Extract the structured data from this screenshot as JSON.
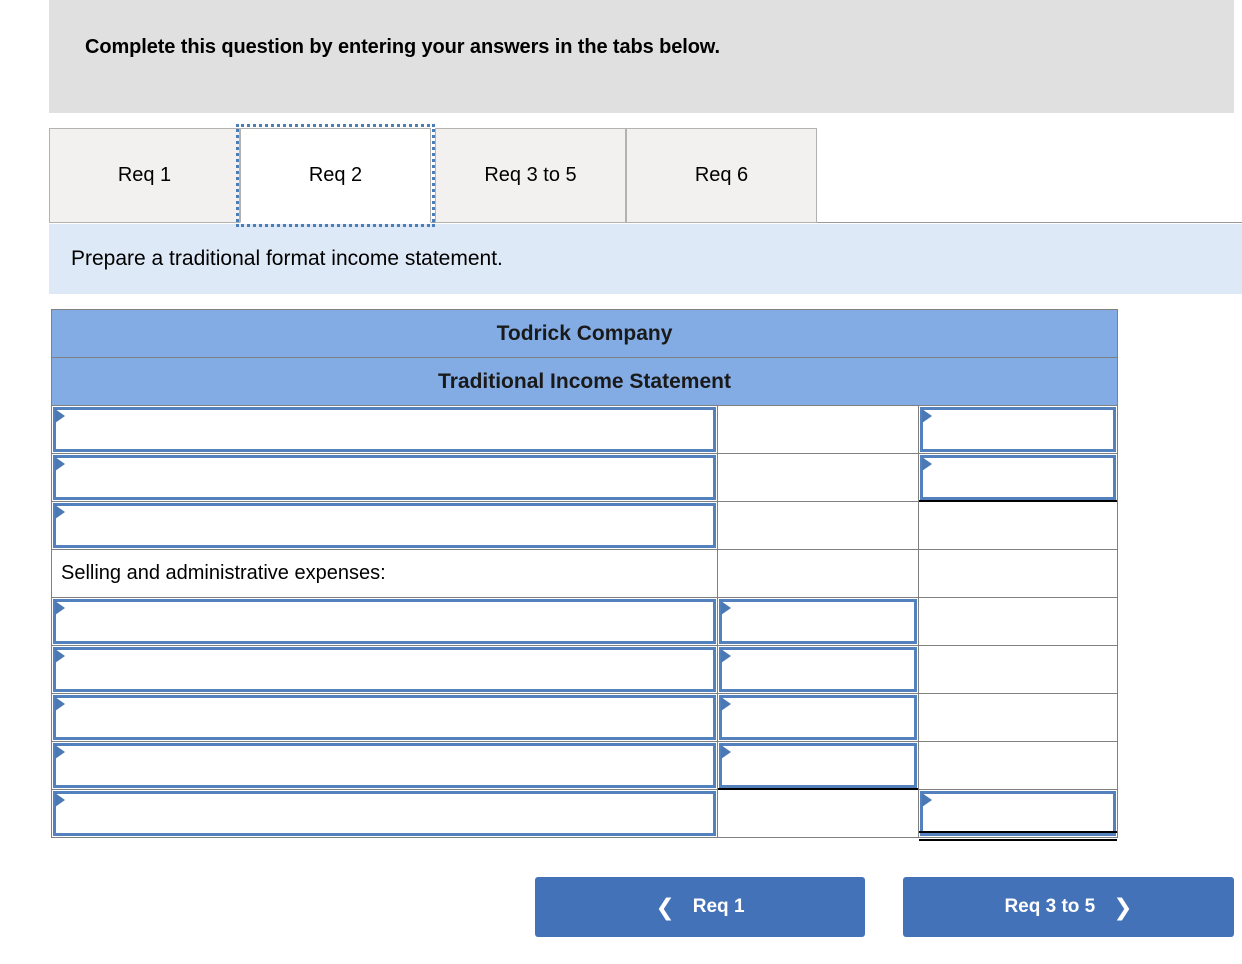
{
  "banner": {
    "text": "Complete this question by entering your answers in the tabs below."
  },
  "tabs": {
    "items": [
      {
        "label": "Req 1",
        "active": false
      },
      {
        "label": "Req 2",
        "active": true
      },
      {
        "label": "Req 3 to 5",
        "active": false
      },
      {
        "label": "Req 6",
        "active": false
      }
    ]
  },
  "prompt": {
    "text": "Prepare a traditional format income statement."
  },
  "worksheet": {
    "title": "Todrick Company",
    "subtitle": "Traditional Income Statement",
    "section_label": "Selling and administrative expenses:",
    "rows": [
      {
        "desc": "",
        "desc_input": true,
        "mid_input": false,
        "right_input": true,
        "right_rule": "none"
      },
      {
        "desc": "",
        "desc_input": true,
        "mid_input": false,
        "right_input": true,
        "right_rule": "single"
      },
      {
        "desc": "",
        "desc_input": true,
        "mid_input": false,
        "right_input": false,
        "right_rule": "none"
      },
      {
        "desc": "",
        "desc_input": true,
        "mid_input": true,
        "right_input": false,
        "right_rule": "none"
      },
      {
        "desc": "",
        "desc_input": true,
        "mid_input": true,
        "right_input": false,
        "right_rule": "none"
      },
      {
        "desc": "",
        "desc_input": true,
        "mid_input": true,
        "right_input": false,
        "right_rule": "none"
      },
      {
        "desc": "",
        "desc_input": true,
        "mid_input": true,
        "right_input": false,
        "right_rule": "none"
      },
      {
        "desc": "",
        "desc_input": true,
        "mid_input": false,
        "right_input": true,
        "right_rule": "double"
      }
    ]
  },
  "footer": {
    "prev_label": "Req 1",
    "prev_icon": "chevron-left-icon",
    "next_label": "Req 3 to 5",
    "next_icon": "chevron-right-icon"
  },
  "colors": {
    "banner_bg": "#e0e0e0",
    "prompt_bg": "#dee9f7",
    "table_header_bg": "#84ace4",
    "dropdown_border": "#5281bd",
    "button_bg": "#4372b8",
    "tab_inactive_bg": "#f2f1f0"
  }
}
